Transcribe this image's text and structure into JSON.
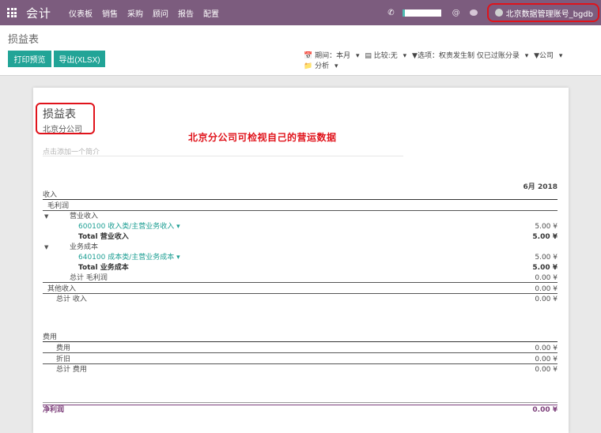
{
  "nav": {
    "brand": "会计",
    "menu": [
      "仪表板",
      "销售",
      "采购",
      "顾问",
      "报告",
      "配置"
    ],
    "user": "北京数据管理账号_bgdb"
  },
  "control": {
    "breadcrumb": "损益表",
    "print_label": "打印预览",
    "export_label": "导出(XLSX)",
    "filters": {
      "period": "期间：本月",
      "compare": "比较:无",
      "options": "选项：权责发生制 仅已过账分录",
      "company": "公司",
      "analysis": "分析"
    }
  },
  "report": {
    "title": "损益表",
    "company": "北京分公司",
    "annotation": "北京分公司可检视自己的营运数据",
    "summary_placeholder": "点击添加一个简介",
    "period_header": "6月 2018",
    "rows": {
      "income": {
        "label": "收入"
      },
      "gross_profit": {
        "label": "毛利润"
      },
      "operating_income": {
        "label": "营业收入"
      },
      "acct_600100": {
        "label": "600100 收入类/主营业务收入",
        "value": "5.00 ¥"
      },
      "total_operating_income": {
        "label": "Total 营业收入",
        "value": "5.00 ¥"
      },
      "cost_of_revenue": {
        "label": "业务成本"
      },
      "acct_640100": {
        "label": "640100 成本类/主营业务成本",
        "value": "5.00 ¥"
      },
      "total_cost_of_revenue": {
        "label": "Total 业务成本",
        "value": "5.00 ¥"
      },
      "total_gross_profit": {
        "label": "总计 毛利润",
        "value": "0.00 ¥"
      },
      "other_income": {
        "label": "其他收入",
        "value": "0.00 ¥"
      },
      "total_income": {
        "label": "总计 收入",
        "value": "0.00 ¥"
      },
      "expenses": {
        "label": "费用"
      },
      "expense": {
        "label": "费用",
        "value": "0.00 ¥"
      },
      "depreciation": {
        "label": "折旧",
        "value": "0.00 ¥"
      },
      "total_expenses": {
        "label": "总计 费用",
        "value": "0.00 ¥"
      },
      "net_profit": {
        "label": "净利润",
        "value": "0.00 ¥"
      }
    }
  }
}
